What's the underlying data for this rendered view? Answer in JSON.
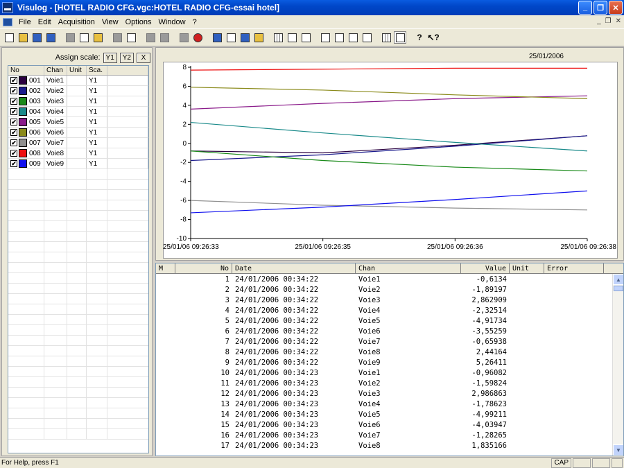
{
  "window": {
    "title": "Visulog - [HOTEL RADIO CFG.vgc:HOTEL RADIO CFG-essai hotel]",
    "minimize": "_",
    "maximize": "❐",
    "close": "✕"
  },
  "menu": {
    "items": [
      "File",
      "Edit",
      "Acquisition",
      "View",
      "Options",
      "Window",
      "?"
    ],
    "mdi": [
      "_",
      "❐",
      "✕"
    ]
  },
  "toolbar": {
    "icons": [
      "new-file-icon",
      "open-folder-icon",
      "save-icon",
      "save-as-icon",
      "cut-icon",
      "copy-icon",
      "paste-icon",
      "print-icon",
      "print-preview-icon",
      "connect-icon",
      "disconnect-icon",
      "settings-icon",
      "stop-icon",
      "acquisition-icon",
      "channel-config-icon",
      "export-icon",
      "chart-icon",
      "grid-icon",
      "zoom-icon",
      "cursor-icon",
      "layout-1-icon",
      "layout-2-icon",
      "layout-3-icon",
      "layout-4-icon",
      "table-icon",
      "curve-icon",
      "help-icon",
      "context-help-icon"
    ]
  },
  "left_panel": {
    "assign_label": "Assign scale:",
    "scale_buttons": [
      "Y1",
      "Y2",
      "X"
    ],
    "headers": [
      "No",
      "Chan",
      "Unit",
      "Sca."
    ],
    "channels": [
      {
        "no": "001",
        "chan": "Voie1",
        "unit": "",
        "sca": "Y1",
        "color": "#2a003f",
        "checked": "✔"
      },
      {
        "no": "002",
        "chan": "Voie2",
        "unit": "",
        "sca": "Y1",
        "color": "#1a1a8c",
        "checked": "✔"
      },
      {
        "no": "003",
        "chan": "Voie3",
        "unit": "",
        "sca": "Y1",
        "color": "#1a8a1a",
        "checked": "✔"
      },
      {
        "no": "004",
        "chan": "Voie4",
        "unit": "",
        "sca": "Y1",
        "color": "#1a8a8a",
        "checked": "✔"
      },
      {
        "no": "005",
        "chan": "Voie5",
        "unit": "",
        "sca": "Y1",
        "color": "#8a1a8a",
        "checked": "✔"
      },
      {
        "no": "006",
        "chan": "Voie6",
        "unit": "",
        "sca": "Y1",
        "color": "#8a8a1a",
        "checked": "✔"
      },
      {
        "no": "007",
        "chan": "Voie7",
        "unit": "",
        "sca": "Y1",
        "color": "#909090",
        "checked": "✔"
      },
      {
        "no": "008",
        "chan": "Voie8",
        "unit": "",
        "sca": "Y1",
        "color": "#ee1010",
        "checked": "✔"
      },
      {
        "no": "009",
        "chan": "Voie9",
        "unit": "",
        "sca": "Y1",
        "color": "#1010ee",
        "checked": "✔"
      }
    ]
  },
  "chart_data": {
    "type": "line",
    "date_label": "25/01/2006",
    "x_ticks": [
      "25/01/06 09:26:33",
      "25/01/06 09:26:35",
      "25/01/06 09:26:36",
      "25/01/06 09:26:38"
    ],
    "x": [
      0,
      1,
      2,
      3
    ],
    "ylim": [
      -10,
      8
    ],
    "y_ticks": [
      8,
      6,
      4,
      2,
      0,
      -2,
      -4,
      -6,
      -8,
      -10
    ],
    "series": [
      {
        "color": "#2a003f",
        "values": [
          -0.8,
          -1.0,
          -0.2,
          0.8
        ]
      },
      {
        "color": "#1a1a8c",
        "values": [
          -1.8,
          -1.2,
          -0.3,
          0.8
        ]
      },
      {
        "color": "#1a8a1a",
        "values": [
          -0.8,
          -1.8,
          -2.5,
          -2.9
        ]
      },
      {
        "color": "#1a8a8a",
        "values": [
          2.2,
          1.1,
          0.1,
          -0.8
        ]
      },
      {
        "color": "#8a1a8a",
        "values": [
          3.6,
          4.2,
          4.7,
          5.0
        ]
      },
      {
        "color": "#8a8a1a",
        "values": [
          5.9,
          5.6,
          5.1,
          4.7
        ]
      },
      {
        "color": "#909090",
        "values": [
          -6.0,
          -6.5,
          -6.8,
          -7.0
        ]
      },
      {
        "color": "#ee1010",
        "values": [
          7.7,
          7.8,
          7.9,
          7.9
        ]
      },
      {
        "color": "#1010ee",
        "values": [
          -7.3,
          -6.7,
          -5.9,
          -5.0
        ]
      }
    ]
  },
  "table": {
    "headers": [
      "M",
      "No",
      "Date",
      "Chan",
      "Value",
      "Unit",
      "Error"
    ],
    "rows": [
      {
        "no": "1",
        "date": "24/01/2006 00:34:22",
        "chan": "Voie1",
        "value": "-0,6134"
      },
      {
        "no": "2",
        "date": "24/01/2006 00:34:22",
        "chan": "Voie2",
        "value": "-1,89197"
      },
      {
        "no": "3",
        "date": "24/01/2006 00:34:22",
        "chan": "Voie3",
        "value": "2,862909"
      },
      {
        "no": "4",
        "date": "24/01/2006 00:34:22",
        "chan": "Voie4",
        "value": "-2,32514"
      },
      {
        "no": "5",
        "date": "24/01/2006 00:34:22",
        "chan": "Voie5",
        "value": "-4,91734"
      },
      {
        "no": "6",
        "date": "24/01/2006 00:34:22",
        "chan": "Voie6",
        "value": "-3,55259"
      },
      {
        "no": "7",
        "date": "24/01/2006 00:34:22",
        "chan": "Voie7",
        "value": "-0,65938"
      },
      {
        "no": "8",
        "date": "24/01/2006 00:34:22",
        "chan": "Voie8",
        "value": "2,44164"
      },
      {
        "no": "9",
        "date": "24/01/2006 00:34:22",
        "chan": "Voie9",
        "value": "5,26411"
      },
      {
        "no": "10",
        "date": "24/01/2006 00:34:23",
        "chan": "Voie1",
        "value": "-0,96082"
      },
      {
        "no": "11",
        "date": "24/01/2006 00:34:23",
        "chan": "Voie2",
        "value": "-1,59824"
      },
      {
        "no": "12",
        "date": "24/01/2006 00:34:23",
        "chan": "Voie3",
        "value": "2,986863"
      },
      {
        "no": "13",
        "date": "24/01/2006 00:34:23",
        "chan": "Voie4",
        "value": "-1,78623"
      },
      {
        "no": "14",
        "date": "24/01/2006 00:34:23",
        "chan": "Voie5",
        "value": "-4,99211"
      },
      {
        "no": "15",
        "date": "24/01/2006 00:34:23",
        "chan": "Voie6",
        "value": "-4,03947"
      },
      {
        "no": "16",
        "date": "24/01/2006 00:34:23",
        "chan": "Voie7",
        "value": "-1,28265"
      },
      {
        "no": "17",
        "date": "24/01/2006 00:34:23",
        "chan": "Voie8",
        "value": "1,835166"
      }
    ]
  },
  "status": {
    "text": "For Help, press F1",
    "cap": "CAP"
  }
}
